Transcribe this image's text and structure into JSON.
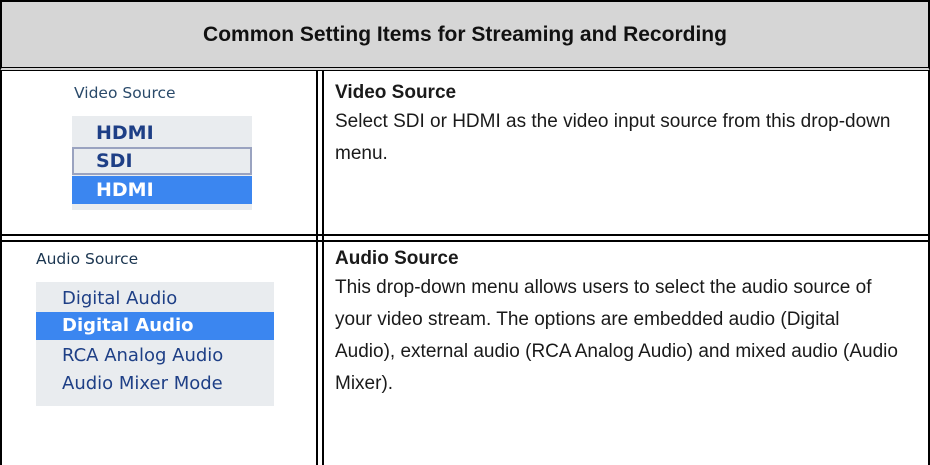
{
  "table": {
    "header": "Common Setting Items for Streaming and Recording",
    "rows": [
      {
        "title": "Video Source",
        "description": "Select SDI or HDMI as the video input source from this drop-down menu.",
        "widget": {
          "label": "Video Source",
          "current": "HDMI",
          "options": [
            "SDI",
            "HDMI"
          ],
          "selected": "HDMI"
        }
      },
      {
        "title": "Audio Source",
        "description": "This drop-down menu allows users to select the audio source of your video stream. The options are embedded audio (Digital Audio), external audio (RCA Analog Audio) and mixed audio (Audio Mixer).",
        "widget": {
          "label": "Audio Source",
          "current": "Digital Audio",
          "options": [
            "Digital Audio",
            "RCA Analog Audio",
            "Audio Mixer Mode"
          ],
          "selected": "Digital Audio"
        }
      }
    ]
  }
}
